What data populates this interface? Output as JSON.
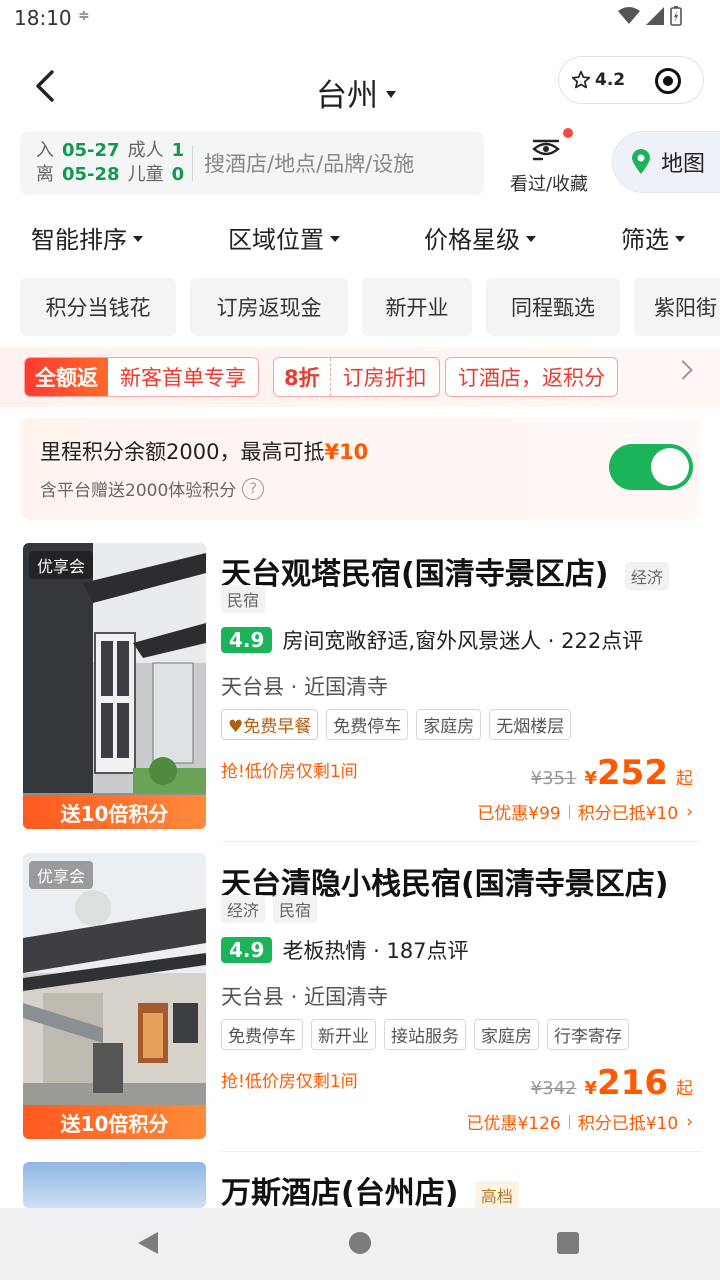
{
  "status": {
    "time": "18:10",
    "sync_icon": "sync-icon"
  },
  "header": {
    "city": "台州",
    "rating": "4.2"
  },
  "search": {
    "checkin_label": "入",
    "checkin_date": "05-27",
    "checkout_label": "离",
    "checkout_date": "05-28",
    "adults_label": "成人",
    "adults": "1",
    "children_label": "儿童",
    "children": "0",
    "placeholder": "搜酒店/地点/品牌/设施",
    "viewed_label": "看过/收藏",
    "map_label": "地图"
  },
  "filters": [
    "智能排序",
    "区域位置",
    "价格星级",
    "筛选"
  ],
  "chips": [
    "积分当钱花",
    "订房返现金",
    "新开业",
    "同程甄选",
    "紫阳街"
  ],
  "promo": {
    "badge1_solid": "全额返",
    "badge1_text": "新客首单专享",
    "badge2_bold": "8折",
    "badge2_text": "订房折扣",
    "badge3_text": "订酒店，返积分"
  },
  "mileage": {
    "text_pre": "里程积分余额2000，最高可抵",
    "text_amount": "¥10",
    "subtext": "含平台赠送2000体验积分",
    "help": "?",
    "toggle_on": true
  },
  "hotels": [
    {
      "member_badge": "优享会",
      "points_band": "送10倍积分",
      "name": "天台观塔民宿(国清寺景区店)",
      "tags": [
        "经济",
        "民宿"
      ],
      "score": "4.9",
      "review": "房间宽敞舒适,窗外风景迷人 · 222点评",
      "location": "天台县 · 近国清寺",
      "amenities": [
        "免费早餐",
        "免费停车",
        "家庭房",
        "无烟楼层"
      ],
      "urgent": "抢!低价房仅剩1间",
      "orig_price": "¥351",
      "currency": "¥",
      "price": "252",
      "qi": "起",
      "discount": "已优惠¥99",
      "points_used": "积分已抵¥10"
    },
    {
      "member_badge": "优享会",
      "points_band": "送10倍积分",
      "name": "天台清隐小栈民宿(国清寺景区店)",
      "tags": [
        "经济",
        "民宿"
      ],
      "score": "4.9",
      "review": "老板热情 · 187点评",
      "location": "天台县 · 近国清寺",
      "amenities": [
        "免费停车",
        "新开业",
        "接站服务",
        "家庭房",
        "行李寄存"
      ],
      "urgent": "抢!低价房仅剩1间",
      "orig_price": "¥342",
      "currency": "¥",
      "price": "216",
      "qi": "起",
      "discount": "已优惠¥126",
      "points_used": "积分已抵¥10"
    },
    {
      "name": "万斯酒店(台州店)",
      "tags": [
        "高档"
      ]
    }
  ],
  "colors": {
    "accent_green": "#1cb45a",
    "price_orange": "#ff5a00",
    "promo_red": "#f0392e"
  }
}
